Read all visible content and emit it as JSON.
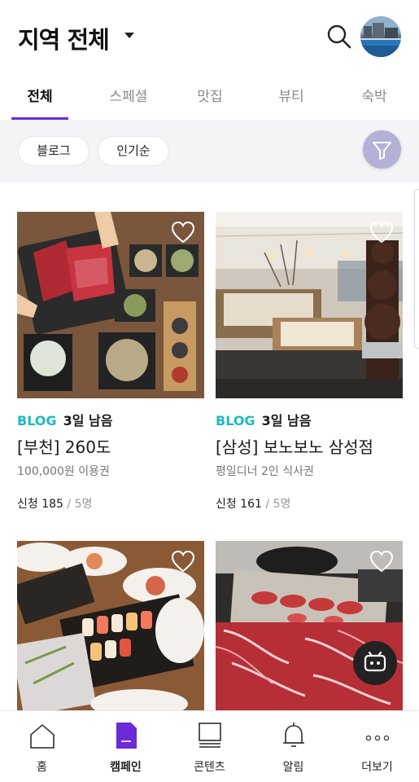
{
  "header": {
    "region_title": "지역 전체",
    "search_icon": "search-icon",
    "avatar_icon": "profile-avatar"
  },
  "tabs": [
    {
      "label": "전체",
      "active": true
    },
    {
      "label": "스페셜",
      "active": false
    },
    {
      "label": "맛집",
      "active": false
    },
    {
      "label": "뷰티",
      "active": false
    },
    {
      "label": "숙박",
      "active": false
    }
  ],
  "filters": {
    "chips": [
      "블로그",
      "인기순"
    ],
    "filter_icon": "funnel-icon"
  },
  "cards": [
    {
      "tag": "BLOG",
      "days_left": "3일 남음",
      "title": "[부천] 260도",
      "subtitle": "100,000원 이용권",
      "apply_label": "신청",
      "apply_count": "185",
      "capacity": "/ 5명"
    },
    {
      "tag": "BLOG",
      "days_left": "3일 남음",
      "title": "[삼성] 보노보노 삼성점",
      "subtitle": "평일디너 2인 식사권",
      "apply_label": "신청",
      "apply_count": "161",
      "capacity": "/ 5명"
    },
    {
      "tag": "",
      "days_left": "",
      "title": "",
      "subtitle": "",
      "apply_label": "",
      "apply_count": "",
      "capacity": ""
    },
    {
      "tag": "",
      "days_left": "",
      "title": "",
      "subtitle": "",
      "apply_label": "",
      "apply_count": "",
      "capacity": ""
    }
  ],
  "bottom_nav": [
    {
      "label": "홈",
      "icon": "home-icon",
      "active": false
    },
    {
      "label": "캠페인",
      "icon": "document-icon",
      "active": true
    },
    {
      "label": "콘텐츠",
      "icon": "content-icon",
      "active": false
    },
    {
      "label": "알림",
      "icon": "bell-icon",
      "active": false
    },
    {
      "label": "더보기",
      "icon": "more-icon",
      "active": false
    }
  ],
  "colors": {
    "accent": "#6b2bd9",
    "blog_tag": "#1fb8c3",
    "filter_fab": "#b3b1d6"
  }
}
